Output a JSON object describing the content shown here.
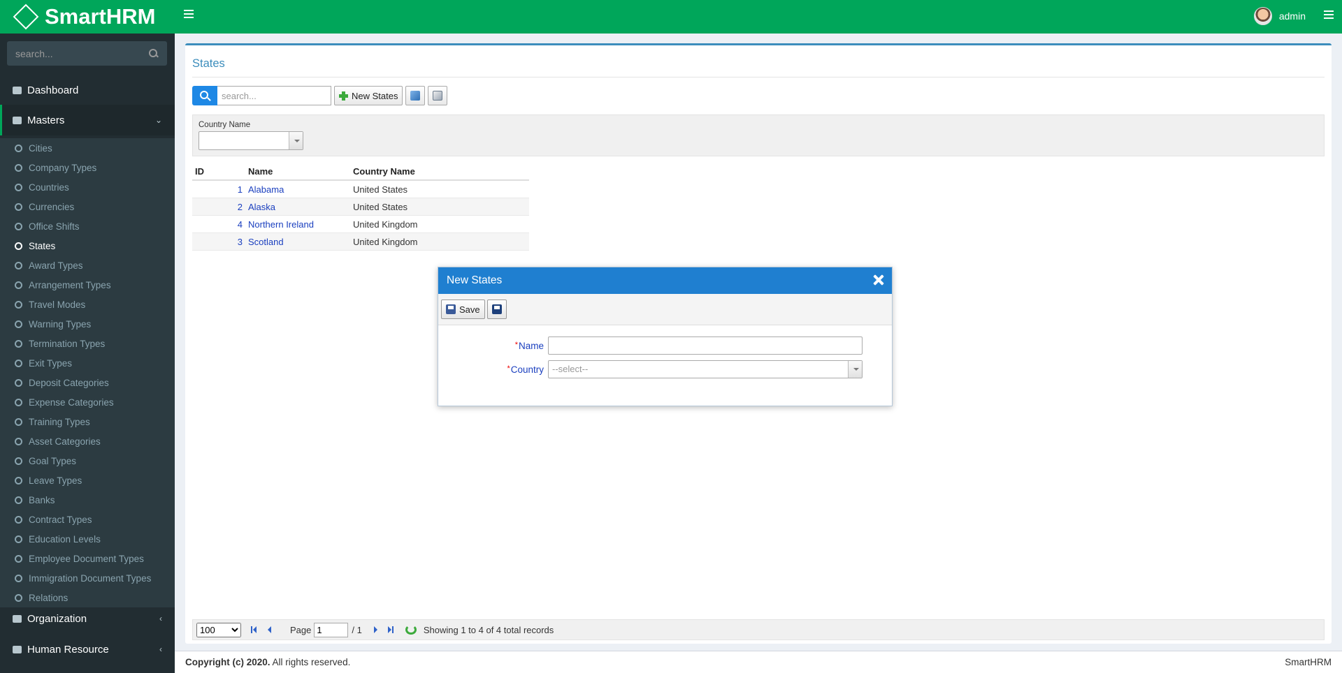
{
  "app": {
    "brand": "SmartHRM",
    "user": "admin"
  },
  "sidebar": {
    "search_placeholder": "search...",
    "dashboard": "Dashboard",
    "masters": "Masters",
    "masters_items": [
      "Cities",
      "Company Types",
      "Countries",
      "Currencies",
      "Office Shifts",
      "States",
      "Award Types",
      "Arrangement Types",
      "Travel Modes",
      "Warning Types",
      "Termination Types",
      "Exit Types",
      "Deposit Categories",
      "Expense Categories",
      "Training Types",
      "Asset Categories",
      "Goal Types",
      "Leave Types",
      "Banks",
      "Contract Types",
      "Education Levels",
      "Employee Document Types",
      "Immigration Document Types",
      "Relations"
    ],
    "active_item": "States",
    "organization": "Organization",
    "human_resource": "Human Resource"
  },
  "page": {
    "title": "States",
    "search_placeholder": "search...",
    "new_button": "New States",
    "filter_label": "Country Name"
  },
  "grid": {
    "headers": {
      "id": "ID",
      "name": "Name",
      "country": "Country Name"
    },
    "rows": [
      {
        "id": "1",
        "name": "Alabama",
        "country": "United States"
      },
      {
        "id": "2",
        "name": "Alaska",
        "country": "United States"
      },
      {
        "id": "4",
        "name": "Northern Ireland",
        "country": "United Kingdom"
      },
      {
        "id": "3",
        "name": "Scotland",
        "country": "United Kingdom"
      }
    ]
  },
  "pager": {
    "page_size": "100",
    "page_label": "Page",
    "page_value": "1",
    "page_total": "/ 1",
    "status": "Showing 1 to 4 of 4 total records"
  },
  "footer": {
    "copyright_bold": "Copyright (c) 2020.",
    "copyright_rest": " All rights reserved.",
    "brand": "SmartHRM"
  },
  "dialog": {
    "title": "New States",
    "save_label": "Save",
    "name_label": "Name",
    "name_value": "",
    "country_label": "Country",
    "country_placeholder": "--select--",
    "required_mark": "*"
  },
  "colors": {
    "header": "#00a65a",
    "sidebar": "#222d32",
    "accent": "#3c8dbc",
    "dialog_header": "#1f7fd0"
  }
}
